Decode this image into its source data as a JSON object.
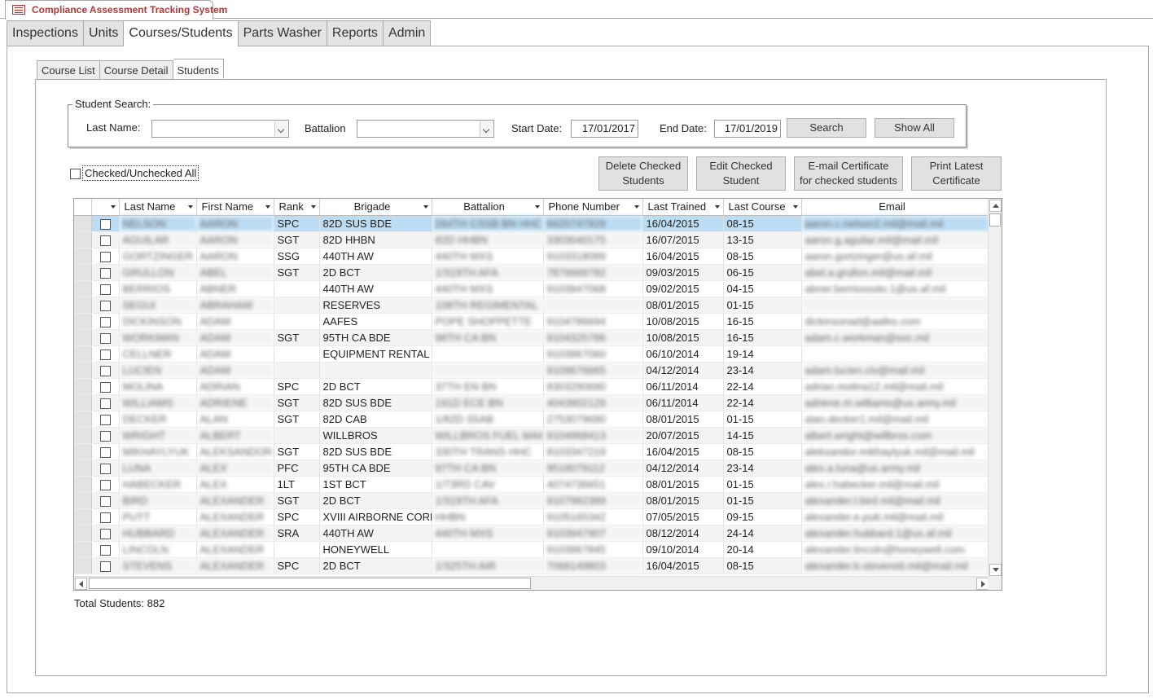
{
  "app": {
    "title": "Compliance Assessment Tracking System",
    "icon": "form-icon"
  },
  "main_tabs": [
    {
      "label": "Inspections"
    },
    {
      "label": "Units"
    },
    {
      "label": "Courses/Students",
      "active": true
    },
    {
      "label": "Parts Washer"
    },
    {
      "label": "Reports"
    },
    {
      "label": "Admin"
    }
  ],
  "sub_tabs": [
    {
      "label": "Course List"
    },
    {
      "label": "Course Detail"
    },
    {
      "label": "Students",
      "active": true
    }
  ],
  "search": {
    "legend": "Student Search:",
    "last_name_label": "Last Name:",
    "last_name_value": "",
    "battalion_label": "Battalion",
    "battalion_value": "",
    "start_date_label": "Start Date:",
    "start_date_value": "17/01/2017",
    "end_date_label": "End Date:",
    "end_date_value": "17/01/2019",
    "search_button": "Search",
    "show_all_button": "Show All"
  },
  "check_all_label": "Checked/Unchecked All",
  "actions": {
    "delete_line1": "Delete Checked",
    "delete_line2": "Students",
    "edit_line1": "Edit Checked",
    "edit_line2": "Student",
    "email_line1": "E-mail Certificate",
    "email_line2": "for checked students",
    "print_line1": "Print Latest",
    "print_line2": "Certificate"
  },
  "grid": {
    "columns": [
      "Last Name",
      "First Name",
      "Rank",
      "Brigade",
      "Battalion",
      "Phone Number",
      "Last Trained",
      "Last Course",
      "Email"
    ],
    "rows": [
      {
        "last": "NELSON",
        "first": "AARON",
        "rank": "SPC",
        "brigade": "82D SUS BDE",
        "battalion": "264TH CSSB BN HHC",
        "phone": "6625747929",
        "trained": "16/04/2015",
        "course": "08-15",
        "email": "aaron.c.nelson2.mil@mail.mil"
      },
      {
        "last": "AGUILAR",
        "first": "AARON",
        "rank": "SGT",
        "brigade": "82D HHBN",
        "battalion": "82D HHBN",
        "phone": "3303040175",
        "trained": "16/07/2015",
        "course": "13-15",
        "email": "aaron.g.aguilar.mil@mail.mil"
      },
      {
        "last": "GORTZINGER",
        "first": "AARON",
        "rank": "SSG",
        "brigade": "440TH AW",
        "battalion": "440TH MXS",
        "phone": "9103318089",
        "trained": "16/04/2015",
        "course": "08-15",
        "email": "aaron.gortzinger@us.af.mil"
      },
      {
        "last": "GRULLON",
        "first": "ABEL",
        "rank": "SGT",
        "brigade": "2D BCT",
        "battalion": "1/319TH AFA",
        "phone": "7876669782",
        "trained": "09/03/2015",
        "course": "06-15",
        "email": "abel.a.grullon.mil@mail.mil"
      },
      {
        "last": "BERRIOS",
        "first": "ABNER",
        "rank": "",
        "brigade": "440TH AW",
        "battalion": "440TH MXS",
        "phone": "9103947068",
        "trained": "09/02/2015",
        "course": "04-15",
        "email": "abner.berriossoto.1@us.af.mil"
      },
      {
        "last": "SEGUI",
        "first": "ABRAHAM",
        "rank": "",
        "brigade": "RESERVES",
        "battalion": "108TH REGIMENTAL",
        "phone": "",
        "trained": "08/01/2015",
        "course": "01-15",
        "email": ""
      },
      {
        "last": "DICKINSON",
        "first": "ADAM",
        "rank": "",
        "brigade": "AAFES",
        "battalion": "POPE SHOPPETTE",
        "phone": "9104786694",
        "trained": "10/08/2015",
        "course": "16-15",
        "email": "dickinsonad@aafes.com"
      },
      {
        "last": "WORKMAN",
        "first": "ADAM",
        "rank": "SGT",
        "brigade": "95TH CA BDE",
        "battalion": "98TH CA BN",
        "phone": "9104325786",
        "trained": "10/08/2015",
        "course": "16-15",
        "email": "adam.c.workman@soc.mil"
      },
      {
        "last": "CELLNER",
        "first": "ADAM",
        "rank": "",
        "brigade": "EQUIPMENT RENTAL",
        "battalion": "",
        "phone": "9103967060",
        "trained": "06/10/2014",
        "course": "19-14",
        "email": ""
      },
      {
        "last": "LUCIEN",
        "first": "ADAM",
        "rank": "",
        "brigade": "",
        "battalion": "",
        "phone": "9109676665",
        "trained": "04/12/2014",
        "course": "23-14",
        "email": "adam.lucien.civ@mail.mil"
      },
      {
        "last": "MOLINA",
        "first": "ADRIAN",
        "rank": "SPC",
        "brigade": "2D BCT",
        "battalion": "37TH EN BN",
        "phone": "8303290690",
        "trained": "06/11/2014",
        "course": "22-14",
        "email": "adrian.molina12.mil@mail.mil"
      },
      {
        "last": "WILLIAMS",
        "first": "ADRIENE",
        "rank": "SGT",
        "brigade": "82D SUS BDE",
        "battalion": "191D ECE BN",
        "phone": "4043902129",
        "trained": "06/11/2014",
        "course": "22-14",
        "email": "adriene.m.williams@us.army.mil"
      },
      {
        "last": "DECKER",
        "first": "ALAN",
        "rank": "SGT",
        "brigade": "82D CAB",
        "battalion": "1/82D 3SAB",
        "phone": "2753079690",
        "trained": "08/01/2015",
        "course": "01-15",
        "email": "alan.decker1.mil@mail.mil"
      },
      {
        "last": "WRIGHT",
        "first": "ALBERT",
        "rank": "",
        "brigade": "WILLBROS",
        "battalion": "WILLBROS FUEL MAINT",
        "phone": "9104968413",
        "trained": "20/07/2015",
        "course": "14-15",
        "email": "albert.wright@willbros.com"
      },
      {
        "last": "MIKHAYLYUK",
        "first": "ALEKSANDOR",
        "rank": "SGT",
        "brigade": "82D SUS BDE",
        "battalion": "330TH TRANS HHC",
        "phone": "8103347219",
        "trained": "16/04/2015",
        "course": "08-15",
        "email": "aleksandor.mikhaylyuk.mil@mail.mil"
      },
      {
        "last": "LUNA",
        "first": "ALEX",
        "rank": "PFC",
        "brigade": "95TH CA BDE",
        "battalion": "97TH CA BN",
        "phone": "9518079112",
        "trained": "04/12/2014",
        "course": "23-14",
        "email": "alex.a.luna@us.army.mil"
      },
      {
        "last": "HABECKER",
        "first": "ALEX",
        "rank": "1LT",
        "brigade": "1ST BCT",
        "battalion": "1/73RD CAV",
        "phone": "4074736651",
        "trained": "08/01/2015",
        "course": "01-15",
        "email": "alex.r.habecker.mil@mail.mil"
      },
      {
        "last": "BIRD",
        "first": "ALEXANDER",
        "rank": "SGT",
        "brigade": "2D BCT",
        "battalion": "1/319TH AFA",
        "phone": "9107992389",
        "trained": "08/01/2015",
        "course": "01-15",
        "email": "alexander.t.bird.mil@mail.mil"
      },
      {
        "last": "PUTT",
        "first": "ALEXANDER",
        "rank": "SPC",
        "brigade": "XVIII AIRBORNE CORP",
        "battalion": "HHBN",
        "phone": "9105165342",
        "trained": "07/05/2015",
        "course": "09-15",
        "email": "alexander.e.putt.mil@mail.mil"
      },
      {
        "last": "HUBBARD",
        "first": "ALEXANDER",
        "rank": "SRA",
        "brigade": "440TH AW",
        "battalion": "440TH MXS",
        "phone": "9103947907",
        "trained": "08/12/2014",
        "course": "24-14",
        "email": "alexander.hubbard.1@us.af.mil"
      },
      {
        "last": "LINCOLN",
        "first": "ALEXANDER",
        "rank": "",
        "brigade": "HONEYWELL",
        "battalion": "",
        "phone": "9103967845",
        "trained": "09/10/2014",
        "course": "20-14",
        "email": "alexander.lincoln@honeywell.com"
      },
      {
        "last": "STEVENS",
        "first": "ALEXANDER",
        "rank": "SPC",
        "brigade": "2D BCT",
        "battalion": "1/325TH AIR",
        "phone": "7066149803",
        "trained": "16/04/2015",
        "course": "08-15",
        "email": "alexander.b.stevens6.mil@mail.mil"
      }
    ]
  },
  "total": "Total Students: 882"
}
